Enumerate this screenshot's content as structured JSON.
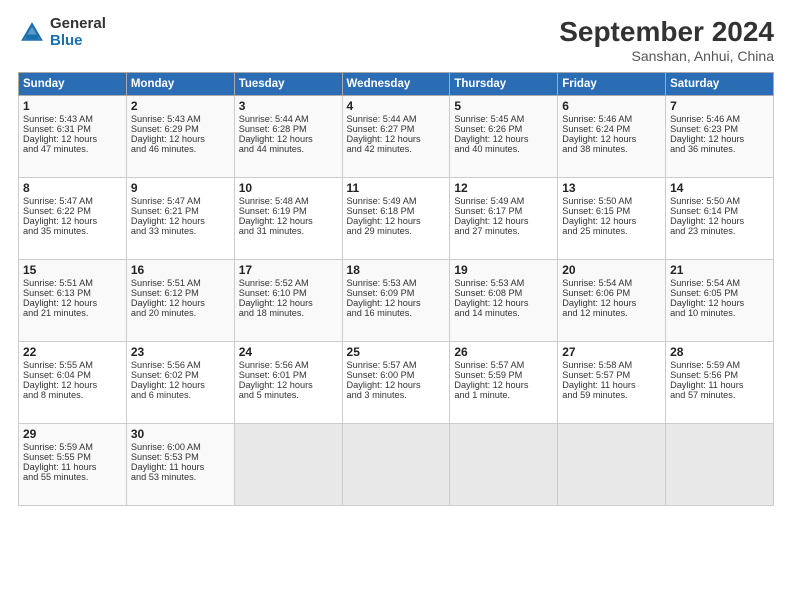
{
  "header": {
    "logo_general": "General",
    "logo_blue": "Blue",
    "title": "September 2024",
    "location": "Sanshan, Anhui, China"
  },
  "days_of_week": [
    "Sunday",
    "Monday",
    "Tuesday",
    "Wednesday",
    "Thursday",
    "Friday",
    "Saturday"
  ],
  "weeks": [
    [
      {
        "day": "1",
        "lines": [
          "Sunrise: 5:43 AM",
          "Sunset: 6:31 PM",
          "Daylight: 12 hours",
          "and 47 minutes."
        ]
      },
      {
        "day": "2",
        "lines": [
          "Sunrise: 5:43 AM",
          "Sunset: 6:29 PM",
          "Daylight: 12 hours",
          "and 46 minutes."
        ]
      },
      {
        "day": "3",
        "lines": [
          "Sunrise: 5:44 AM",
          "Sunset: 6:28 PM",
          "Daylight: 12 hours",
          "and 44 minutes."
        ]
      },
      {
        "day": "4",
        "lines": [
          "Sunrise: 5:44 AM",
          "Sunset: 6:27 PM",
          "Daylight: 12 hours",
          "and 42 minutes."
        ]
      },
      {
        "day": "5",
        "lines": [
          "Sunrise: 5:45 AM",
          "Sunset: 6:26 PM",
          "Daylight: 12 hours",
          "and 40 minutes."
        ]
      },
      {
        "day": "6",
        "lines": [
          "Sunrise: 5:46 AM",
          "Sunset: 6:24 PM",
          "Daylight: 12 hours",
          "and 38 minutes."
        ]
      },
      {
        "day": "7",
        "lines": [
          "Sunrise: 5:46 AM",
          "Sunset: 6:23 PM",
          "Daylight: 12 hours",
          "and 36 minutes."
        ]
      }
    ],
    [
      {
        "day": "8",
        "lines": [
          "Sunrise: 5:47 AM",
          "Sunset: 6:22 PM",
          "Daylight: 12 hours",
          "and 35 minutes."
        ]
      },
      {
        "day": "9",
        "lines": [
          "Sunrise: 5:47 AM",
          "Sunset: 6:21 PM",
          "Daylight: 12 hours",
          "and 33 minutes."
        ]
      },
      {
        "day": "10",
        "lines": [
          "Sunrise: 5:48 AM",
          "Sunset: 6:19 PM",
          "Daylight: 12 hours",
          "and 31 minutes."
        ]
      },
      {
        "day": "11",
        "lines": [
          "Sunrise: 5:49 AM",
          "Sunset: 6:18 PM",
          "Daylight: 12 hours",
          "and 29 minutes."
        ]
      },
      {
        "day": "12",
        "lines": [
          "Sunrise: 5:49 AM",
          "Sunset: 6:17 PM",
          "Daylight: 12 hours",
          "and 27 minutes."
        ]
      },
      {
        "day": "13",
        "lines": [
          "Sunrise: 5:50 AM",
          "Sunset: 6:15 PM",
          "Daylight: 12 hours",
          "and 25 minutes."
        ]
      },
      {
        "day": "14",
        "lines": [
          "Sunrise: 5:50 AM",
          "Sunset: 6:14 PM",
          "Daylight: 12 hours",
          "and 23 minutes."
        ]
      }
    ],
    [
      {
        "day": "15",
        "lines": [
          "Sunrise: 5:51 AM",
          "Sunset: 6:13 PM",
          "Daylight: 12 hours",
          "and 21 minutes."
        ]
      },
      {
        "day": "16",
        "lines": [
          "Sunrise: 5:51 AM",
          "Sunset: 6:12 PM",
          "Daylight: 12 hours",
          "and 20 minutes."
        ]
      },
      {
        "day": "17",
        "lines": [
          "Sunrise: 5:52 AM",
          "Sunset: 6:10 PM",
          "Daylight: 12 hours",
          "and 18 minutes."
        ]
      },
      {
        "day": "18",
        "lines": [
          "Sunrise: 5:53 AM",
          "Sunset: 6:09 PM",
          "Daylight: 12 hours",
          "and 16 minutes."
        ]
      },
      {
        "day": "19",
        "lines": [
          "Sunrise: 5:53 AM",
          "Sunset: 6:08 PM",
          "Daylight: 12 hours",
          "and 14 minutes."
        ]
      },
      {
        "day": "20",
        "lines": [
          "Sunrise: 5:54 AM",
          "Sunset: 6:06 PM",
          "Daylight: 12 hours",
          "and 12 minutes."
        ]
      },
      {
        "day": "21",
        "lines": [
          "Sunrise: 5:54 AM",
          "Sunset: 6:05 PM",
          "Daylight: 12 hours",
          "and 10 minutes."
        ]
      }
    ],
    [
      {
        "day": "22",
        "lines": [
          "Sunrise: 5:55 AM",
          "Sunset: 6:04 PM",
          "Daylight: 12 hours",
          "and 8 minutes."
        ]
      },
      {
        "day": "23",
        "lines": [
          "Sunrise: 5:56 AM",
          "Sunset: 6:02 PM",
          "Daylight: 12 hours",
          "and 6 minutes."
        ]
      },
      {
        "day": "24",
        "lines": [
          "Sunrise: 5:56 AM",
          "Sunset: 6:01 PM",
          "Daylight: 12 hours",
          "and 5 minutes."
        ]
      },
      {
        "day": "25",
        "lines": [
          "Sunrise: 5:57 AM",
          "Sunset: 6:00 PM",
          "Daylight: 12 hours",
          "and 3 minutes."
        ]
      },
      {
        "day": "26",
        "lines": [
          "Sunrise: 5:57 AM",
          "Sunset: 5:59 PM",
          "Daylight: 12 hours",
          "and 1 minute."
        ]
      },
      {
        "day": "27",
        "lines": [
          "Sunrise: 5:58 AM",
          "Sunset: 5:57 PM",
          "Daylight: 11 hours",
          "and 59 minutes."
        ]
      },
      {
        "day": "28",
        "lines": [
          "Sunrise: 5:59 AM",
          "Sunset: 5:56 PM",
          "Daylight: 11 hours",
          "and 57 minutes."
        ]
      }
    ],
    [
      {
        "day": "29",
        "lines": [
          "Sunrise: 5:59 AM",
          "Sunset: 5:55 PM",
          "Daylight: 11 hours",
          "and 55 minutes."
        ]
      },
      {
        "day": "30",
        "lines": [
          "Sunrise: 6:00 AM",
          "Sunset: 5:53 PM",
          "Daylight: 11 hours",
          "and 53 minutes."
        ]
      },
      {
        "day": "",
        "lines": []
      },
      {
        "day": "",
        "lines": []
      },
      {
        "day": "",
        "lines": []
      },
      {
        "day": "",
        "lines": []
      },
      {
        "day": "",
        "lines": []
      }
    ]
  ]
}
